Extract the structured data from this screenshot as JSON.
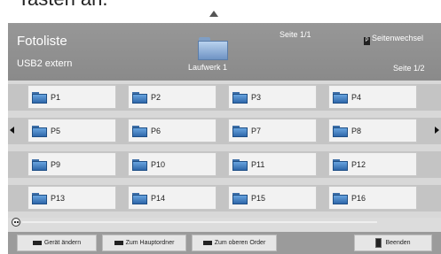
{
  "top": {
    "caption_partial": "Tasten an.",
    "arrow_icon": "triangle-up-icon"
  },
  "header": {
    "title": "Fotoliste",
    "device": "USB2 extern",
    "drive_label": "Laufwerk 1",
    "drive_icon": "folder-icon",
    "page_center": "Seite 1/1",
    "page_switch_key": "P",
    "page_switch_label": "Seitenwechsel",
    "page_right": "Seite 1/2"
  },
  "grid": {
    "nav_left_icon": "arrow-left-icon",
    "nav_right_icon": "arrow-right-icon",
    "tile_icon": "folder-icon",
    "rows": [
      [
        "P1",
        "P2",
        "P3",
        "P4"
      ],
      [
        "P5",
        "P6",
        "P7",
        "P8"
      ],
      [
        "P9",
        "P10",
        "P11",
        "P12"
      ],
      [
        "P13",
        "P14",
        "P15",
        "P16"
      ]
    ]
  },
  "footer": {
    "buttons": [
      {
        "label": "Gerät ändern"
      },
      {
        "label": "Zum Hauptordner"
      },
      {
        "label": "Zum oberen Order"
      },
      {
        "label": "Beenden"
      }
    ]
  }
}
